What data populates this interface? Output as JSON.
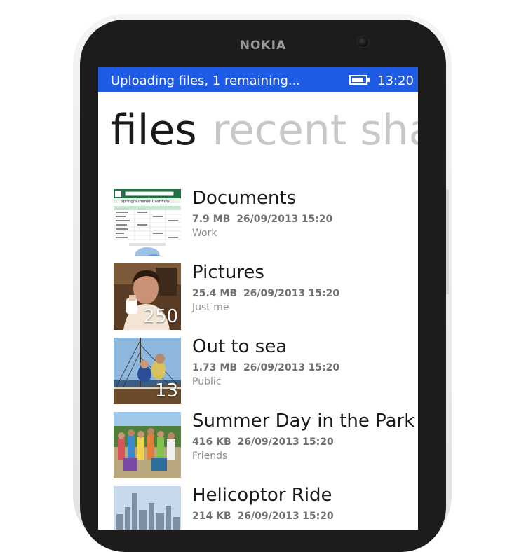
{
  "device": {
    "brand": "NOKIA"
  },
  "status_bar": {
    "message": "Uploading files, 1 remaining...",
    "time": "13:20",
    "battery_level": 0.9,
    "background_color": "#1f5ce6"
  },
  "pivot": {
    "active": "files",
    "next": "recent sha"
  },
  "files": [
    {
      "name": "Documents",
      "size": "7.9 MB",
      "date": "26/09/2013",
      "time": "15:20",
      "share": "Work",
      "count": "",
      "thumb_icon": "spreadsheet-thumbnail",
      "thumb_text": "Spring/Summer Cashflow"
    },
    {
      "name": "Pictures",
      "size": "25.4 MB",
      "date": "26/09/2013",
      "time": "15:20",
      "share": "Just me",
      "count": "250",
      "thumb_icon": "woman-portrait-photo"
    },
    {
      "name": "Out to sea",
      "size": "1.73 MB",
      "date": "26/09/2013",
      "time": "15:20",
      "share": "Public",
      "count": "13",
      "thumb_icon": "sailboat-photo"
    },
    {
      "name": "Summer Day in the Park",
      "size": "416 KB",
      "date": "26/09/2013",
      "time": "15:20",
      "share": "Friends",
      "count": "",
      "thumb_icon": "group-in-park-photo"
    },
    {
      "name": "Helicoptor Ride",
      "size": "214 KB",
      "date": "26/09/2013",
      "time": "15:20",
      "share": "",
      "count": "",
      "thumb_icon": "city-skyline-photo"
    }
  ]
}
